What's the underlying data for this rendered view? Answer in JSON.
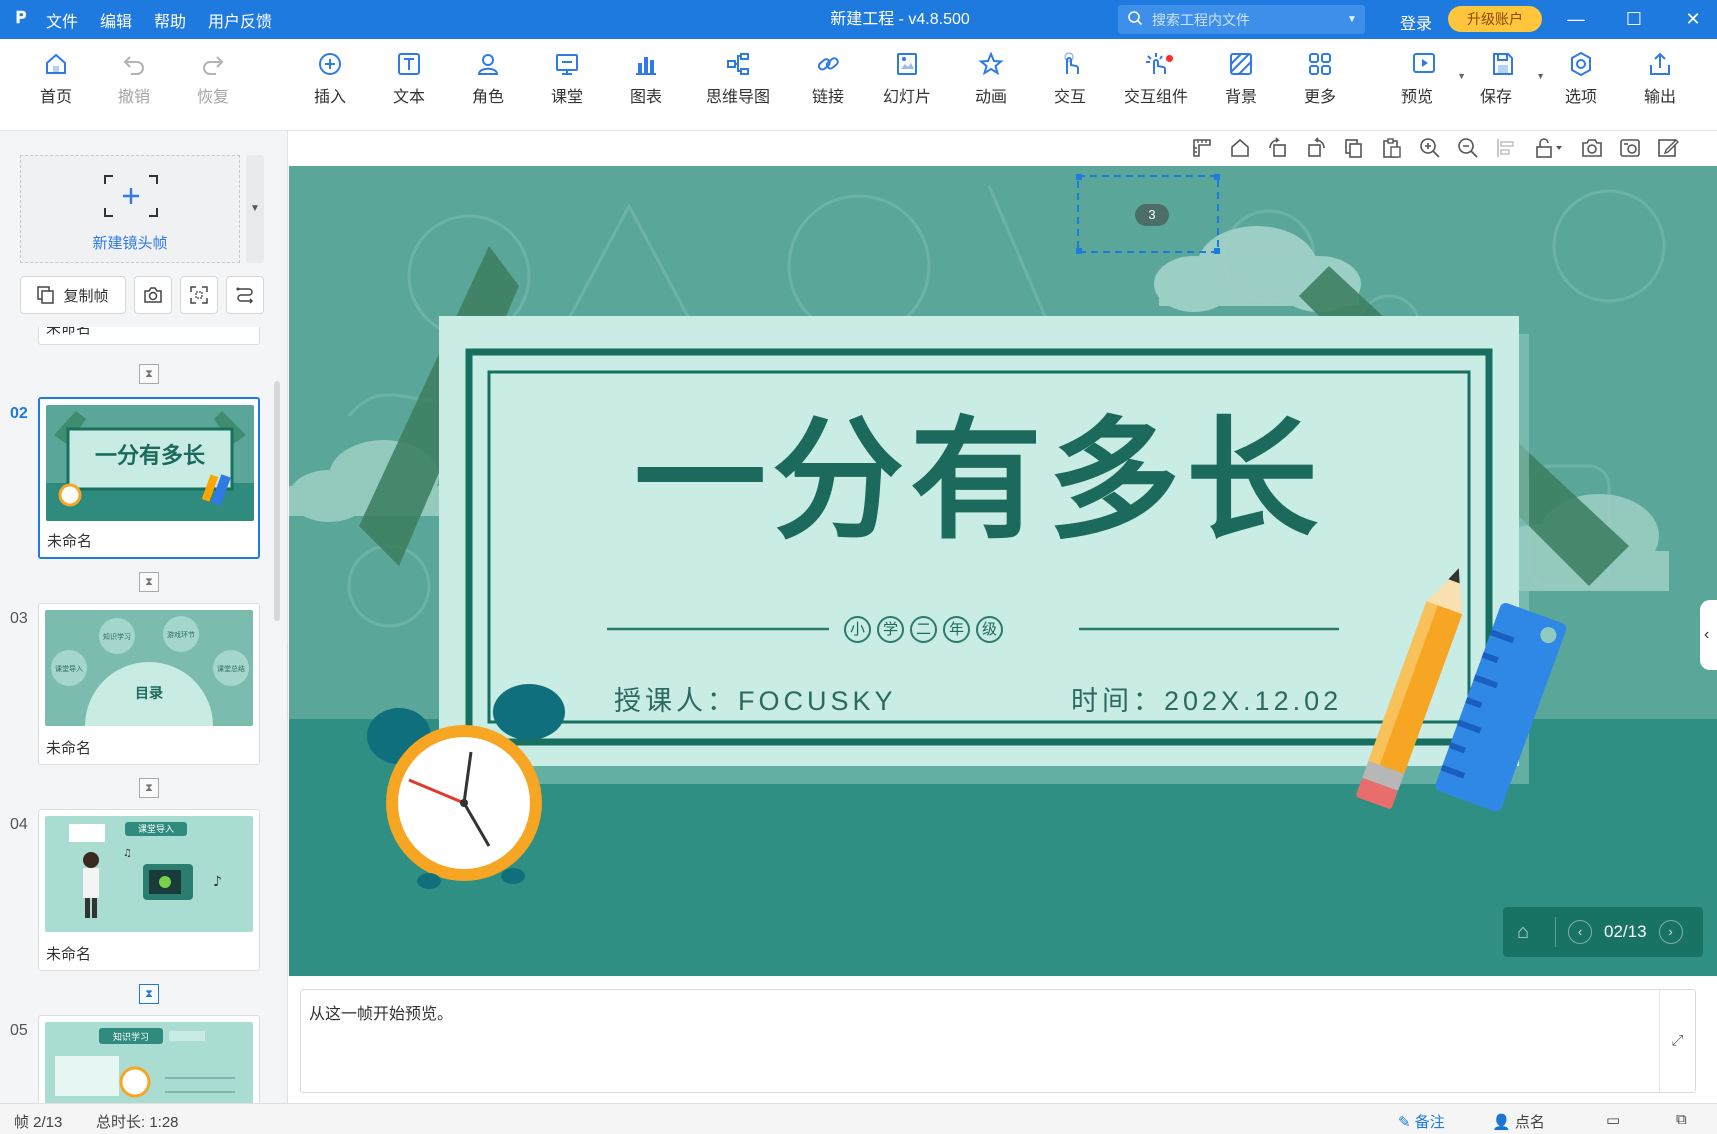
{
  "app": {
    "logo": "𝐏",
    "title": "新建工程 - v4.8.500",
    "menu": [
      "文件",
      "编辑",
      "帮助",
      "用户反馈"
    ],
    "search_placeholder": "搜索工程内文件",
    "login": "登录",
    "upgrade": "升级账户"
  },
  "toolbar": {
    "items": [
      {
        "label": "首页",
        "icon": "home-icon"
      },
      {
        "label": "撤销",
        "icon": "undo-icon"
      },
      {
        "label": "恢复",
        "icon": "redo-icon"
      },
      {
        "label": "插入",
        "icon": "insert-icon"
      },
      {
        "label": "文本",
        "icon": "text-icon"
      },
      {
        "label": "角色",
        "icon": "character-icon"
      },
      {
        "label": "课堂",
        "icon": "classroom-icon"
      },
      {
        "label": "图表",
        "icon": "chart-icon"
      },
      {
        "label": "思维导图",
        "icon": "mindmap-icon"
      },
      {
        "label": "链接",
        "icon": "link-icon"
      },
      {
        "label": "幻灯片",
        "icon": "slideshow-icon"
      },
      {
        "label": "动画",
        "icon": "animation-icon"
      },
      {
        "label": "交互",
        "icon": "interaction-icon"
      },
      {
        "label": "交互组件",
        "icon": "interactive-widget-icon"
      },
      {
        "label": "背景",
        "icon": "background-icon"
      },
      {
        "label": "更多",
        "icon": "more-icon"
      },
      {
        "label": "预览",
        "icon": "preview-icon"
      },
      {
        "label": "保存",
        "icon": "save-icon"
      },
      {
        "label": "选项",
        "icon": "options-icon"
      },
      {
        "label": "输出",
        "icon": "export-icon"
      }
    ]
  },
  "left_panel": {
    "new_frame": "新建镜头帧",
    "copy_frame": "复制帧",
    "partial_label": "未命名",
    "frames": [
      {
        "num": "02",
        "name": "未命名",
        "active": true
      },
      {
        "num": "03",
        "name": "未命名",
        "active": false
      },
      {
        "num": "04",
        "name": "未命名",
        "active": false
      },
      {
        "num": "05",
        "name": "",
        "active": false
      }
    ]
  },
  "stage": {
    "badge": "3",
    "title": "一分有多长",
    "grade_chars": [
      "小",
      "学",
      "二",
      "年",
      "级"
    ],
    "teacher": "授课人：FOCUSKY",
    "time": "时间：202X.12.02",
    "page_counter": "02/13"
  },
  "thumbs": {
    "t02": {
      "title": "一分有多长"
    },
    "t03": {
      "title": "目录",
      "bubbles": [
        "知识学习",
        "游戏环节",
        "课堂导入",
        "课堂总结"
      ]
    },
    "t04": {
      "tag": "课堂导入"
    },
    "t05": {
      "tag": "知识学习"
    }
  },
  "notes": {
    "text": "从这一帧开始预览。"
  },
  "status": {
    "frame": "帧 2/13",
    "duration": "总时长: 1:28",
    "notes_btn": "备注",
    "rollcall_btn": "点名"
  },
  "colors": {
    "brand": "#1f7ae0",
    "stage_bg": "#5aa79a",
    "title_green": "#1b6a5c",
    "upgrade": "#ffc53d"
  }
}
